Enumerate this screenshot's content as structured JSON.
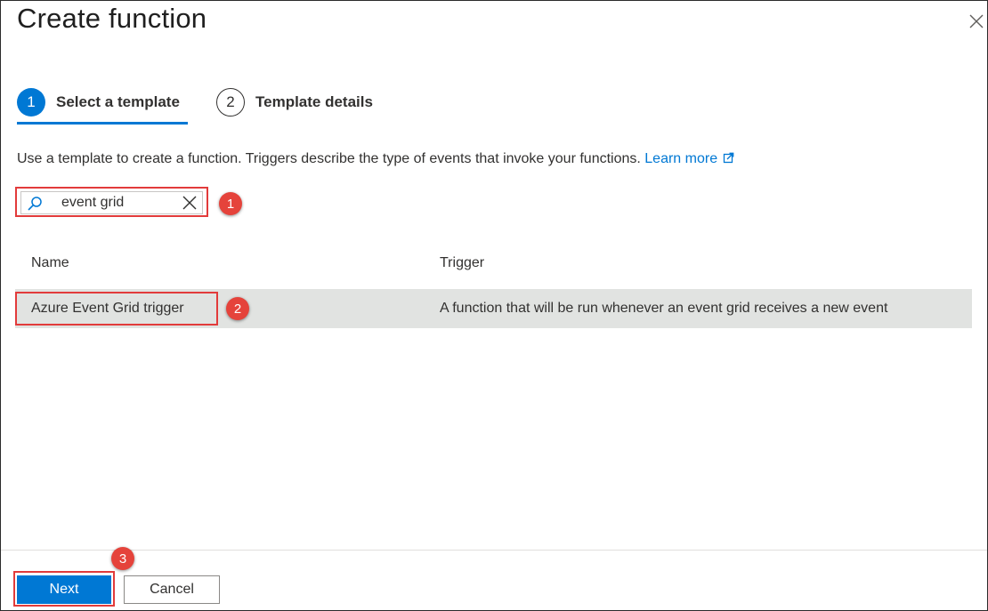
{
  "dialog": {
    "title": "Create function",
    "close_icon": "close-icon"
  },
  "steps": [
    {
      "number": "1",
      "label": "Select a template",
      "active": true
    },
    {
      "number": "2",
      "label": "Template details",
      "active": false
    }
  ],
  "description": {
    "text": "Use a template to create a function. Triggers describe the type of events that invoke your functions.",
    "link_label": "Learn more",
    "link_icon": "external-link-icon"
  },
  "search": {
    "value": "event grid",
    "search_icon": "search-icon",
    "clear_icon": "clear-icon"
  },
  "table": {
    "columns": [
      "Name",
      "Trigger"
    ],
    "rows": [
      {
        "name": "Azure Event Grid trigger",
        "trigger": "A function that will be run whenever an event grid receives a new event",
        "selected": true
      }
    ]
  },
  "annotations": [
    "1",
    "2",
    "3"
  ],
  "footer": {
    "next_label": "Next",
    "cancel_label": "Cancel"
  },
  "colors": {
    "accent": "#0078d4",
    "highlight": "#e23b3b",
    "selected_row": "#e1e3e1",
    "badge": "#e5433b"
  }
}
